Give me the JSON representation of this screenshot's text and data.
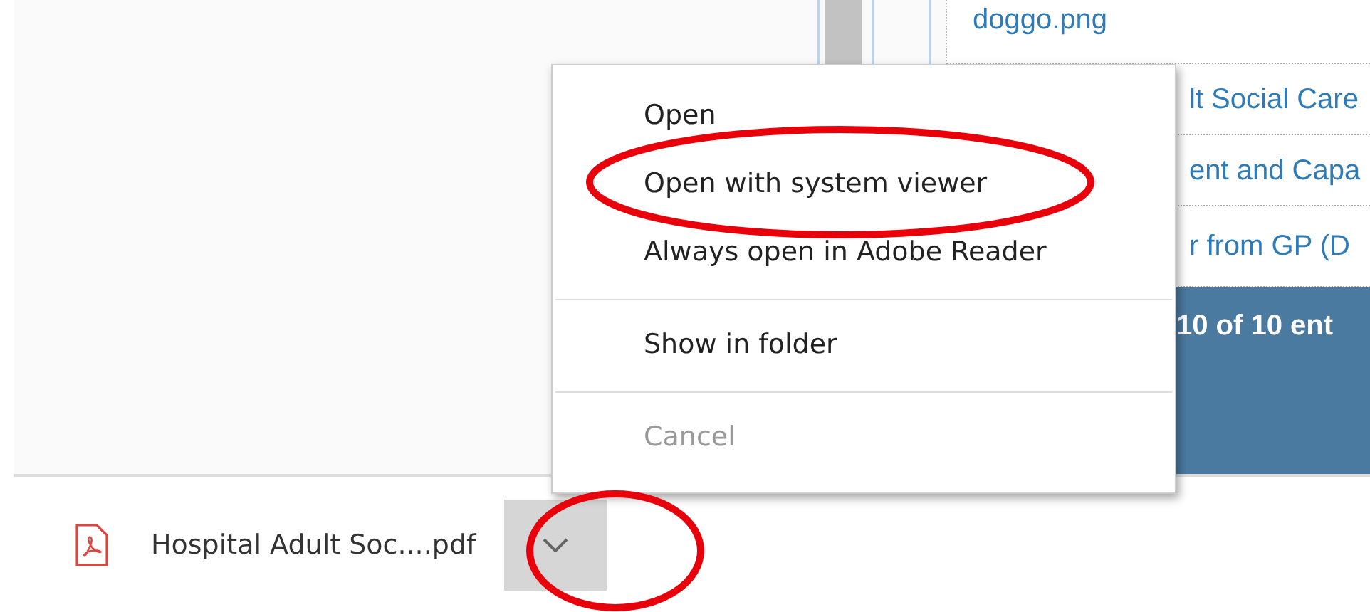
{
  "page_table": {
    "rows": [
      {
        "kind": "file",
        "text": "doggo.png"
      },
      {
        "kind": "link",
        "text": "lt Social Care"
      },
      {
        "kind": "link",
        "text": "ent and Capa"
      },
      {
        "kind": "link",
        "text": "r from GP (D"
      }
    ],
    "footer": "10 of 10 ent"
  },
  "context_menu": {
    "groups": [
      [
        {
          "label": "Open",
          "disabled": false,
          "circled": false
        },
        {
          "label": "Open with system viewer",
          "disabled": false,
          "circled": true
        },
        {
          "label": "Always open in Adobe Reader",
          "disabled": false,
          "circled": false
        }
      ],
      [
        {
          "label": "Show in folder",
          "disabled": false,
          "circled": false
        }
      ],
      [
        {
          "label": "Cancel",
          "disabled": true,
          "circled": false
        }
      ]
    ]
  },
  "download_bar": {
    "file_name": "Hospital Adult Soc....pdf",
    "menu_button_circled": true
  }
}
